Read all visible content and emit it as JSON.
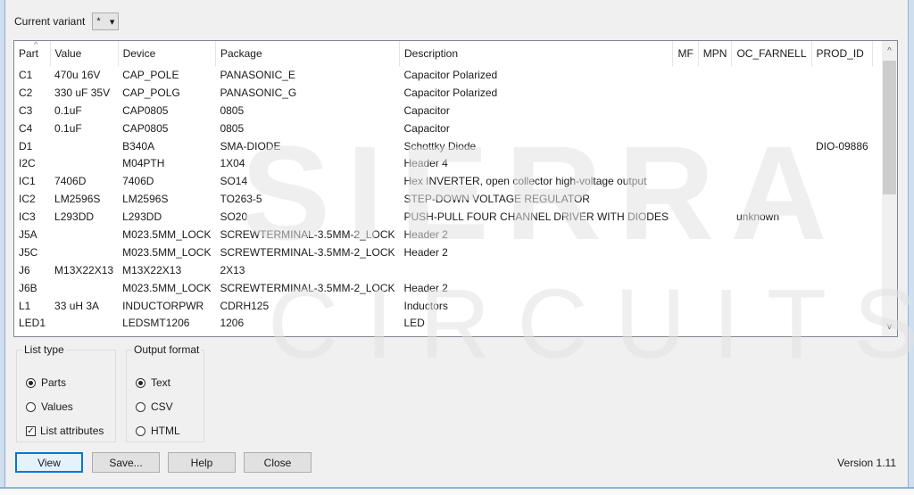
{
  "variant": {
    "label": "Current variant",
    "value": "*"
  },
  "table": {
    "columns": [
      "Part",
      "Value",
      "Device",
      "Package",
      "Description",
      "MF",
      "MPN",
      "OC_FARNELL",
      "PROD_ID"
    ],
    "rows": [
      [
        "C1",
        "470u 16V",
        "CAP_POLE",
        "PANASONIC_E",
        "Capacitor Polarized",
        "",
        "",
        "",
        ""
      ],
      [
        "C2",
        "330 uF 35V",
        "CAP_POLG",
        "PANASONIC_G",
        "Capacitor Polarized",
        "",
        "",
        "",
        ""
      ],
      [
        "C3",
        "0.1uF",
        "CAP0805",
        "0805",
        "Capacitor",
        "",
        "",
        "",
        ""
      ],
      [
        "C4",
        "0.1uF",
        "CAP0805",
        "0805",
        "Capacitor",
        "",
        "",
        "",
        ""
      ],
      [
        "D1",
        "",
        "B340A",
        "SMA-DIODE",
        "Schottky Diode",
        "",
        "",
        "",
        "DIO-09886"
      ],
      [
        "I2C",
        "",
        "M04PTH",
        "1X04",
        "Header 4",
        "",
        "",
        "",
        ""
      ],
      [
        "IC1",
        "7406D",
        "7406D",
        "SO14",
        "Hex INVERTER, open collector high-voltage output",
        "",
        "",
        "",
        ""
      ],
      [
        "IC2",
        "LM2596S",
        "LM2596S",
        "TO263-5",
        "STEP-DOWN VOLTAGE REGULATOR",
        "",
        "",
        "",
        ""
      ],
      [
        "IC3",
        "L293DD",
        "L293DD",
        "SO20",
        "PUSH-PULL FOUR CHANNEL DRIVER WITH DIODES",
        "",
        "",
        "unknown",
        ""
      ],
      [
        "J5A",
        "",
        "M023.5MM_LOCK",
        "SCREWTERMINAL-3.5MM-2_LOCK",
        "Header 2",
        "",
        "",
        "",
        ""
      ],
      [
        "J5C",
        "",
        "M023.5MM_LOCK",
        "SCREWTERMINAL-3.5MM-2_LOCK",
        "Header 2",
        "",
        "",
        "",
        ""
      ],
      [
        "J6",
        "M13X22X13",
        "M13X22X13",
        "2X13",
        "",
        "",
        "",
        "",
        ""
      ],
      [
        "J6B",
        "",
        "M023.5MM_LOCK",
        "SCREWTERMINAL-3.5MM-2_LOCK",
        "Header 2",
        "",
        "",
        "",
        ""
      ],
      [
        "L1",
        "33 uH 3A",
        "INDUCTORPWR",
        "CDRH125",
        "Inductors",
        "",
        "",
        "",
        ""
      ],
      [
        "LED1",
        "",
        "LEDSMT1206",
        "1206",
        "LED",
        "",
        "",
        "",
        ""
      ]
    ]
  },
  "list_type": {
    "title": "List type",
    "options": [
      {
        "label": "Parts",
        "selected": true
      },
      {
        "label": "Values",
        "selected": false
      }
    ],
    "list_attributes": {
      "label": "List attributes",
      "checked": true
    }
  },
  "output_format": {
    "title": "Output format",
    "options": [
      {
        "label": "Text",
        "selected": true
      },
      {
        "label": "CSV",
        "selected": false
      },
      {
        "label": "HTML",
        "selected": false
      }
    ]
  },
  "buttons": {
    "view": "View",
    "save": "Save...",
    "help": "Help",
    "close": "Close"
  },
  "version": "Version 1.11",
  "watermark": {
    "line1": "SIERRA",
    "line2": "CIRCUITS"
  }
}
